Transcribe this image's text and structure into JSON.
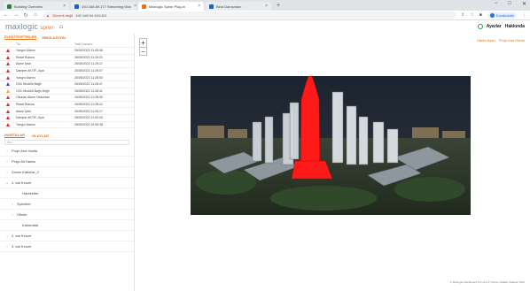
{
  "browser": {
    "tabs": [
      {
        "label": "Building Overview",
        "active": false,
        "color": "#2e7d32"
      },
      {
        "label": "192.168.89.177 Streaming Mon",
        "active": false,
        "color": "#1565c0"
      },
      {
        "label": "Maxlogic Sprwr Plug-in",
        "active": true,
        "color": "#e8711c"
      },
      {
        "label": "Bina Danışmanı",
        "active": false,
        "color": "#1565c0"
      }
    ],
    "new_tab": "+",
    "window_controls": [
      "−",
      "□",
      "✕"
    ],
    "url_warning": "Güvenli değil",
    "url": "192.168.94.34/1451",
    "profile_label": "Duraklatıldı"
  },
  "header": {
    "logo_main": "maxlogic",
    "logo_sub": "sprwr",
    "nav_links": [
      "Ayarlar",
      "Hakkında"
    ]
  },
  "alarms": {
    "tabs": [
      "ELEKTROPTİKLER",
      "SİMÜLASYON"
    ],
    "columns": [
      "Tür",
      "Tarih Zamanı"
    ],
    "rows": [
      {
        "type": "Yangın Alarmı",
        "time": "26/05/2022 11:49:46",
        "color": "#d32f2f"
      },
      {
        "type": "Reset Butonu",
        "time": "26/05/2022 11:29:22",
        "color": "#d32f2f"
      },
      {
        "type": "Alarm İptal",
        "time": "26/05/2022 11:29:17",
        "color": "#d32f2f"
      },
      {
        "type": "Damper AKTİF–Açık",
        "time": "26/05/2022 11:29:07",
        "color": "#d32f2f"
      },
      {
        "type": "Yangın Alarmı",
        "time": "26/05/2022 11:28:53",
        "color": "#d32f2f"
      },
      {
        "type": "GOL Modülü Bağlı",
        "time": "26/05/2022 11:28:47",
        "color": "#3949ab"
      },
      {
        "type": "GOL Modülü Bağlı Değil",
        "time": "26/05/2022 11:28:41",
        "color": "#f9a825"
      },
      {
        "type": "Okunan Alarm Dekontarı",
        "time": "26/05/2022 11:28:30",
        "color": "#d32f2f"
      },
      {
        "type": "Reset Butonu",
        "time": "26/05/2022 11:28:22",
        "color": "#d32f2f"
      },
      {
        "type": "Alarm İptal",
        "time": "26/05/2022 11:00:17",
        "color": "#d32f2f"
      },
      {
        "type": "Damper AKTİF–Açık",
        "time": "26/05/2022 11:00:04",
        "color": "#d32f2f"
      },
      {
        "type": "Yangın Alarmı",
        "time": "26/05/2022 10:59:38",
        "color": "#d32f2f"
      }
    ]
  },
  "tree": {
    "tabs": [
      "HARİTALAR",
      "OLAYLAR"
    ],
    "search_placeholder": "Ara",
    "items": [
      {
        "label": "Proje Ana Harita",
        "level": 0,
        "chevron": "›"
      },
      {
        "label": "Proje Alt Harita",
        "level": 0,
        "chevron": "›"
      },
      {
        "label": "Zemin Katlıklar_2",
        "level": 0,
        "chevron": "›"
      },
      {
        "label": "1. kat Keuze",
        "level": 0,
        "chevron": "⌄"
      },
      {
        "label": "Hareketler",
        "level": 2,
        "chevron": ""
      },
      {
        "label": "Sprinkler",
        "level": 1,
        "chevron": "›"
      },
      {
        "label": "Ofisler",
        "level": 1,
        "chevron": "›"
      },
      {
        "label": "Kameralar",
        "level": 2,
        "chevron": ""
      },
      {
        "label": "2. kat Keuze",
        "level": 0,
        "chevron": "›"
      },
      {
        "label": "3. kat Keuze",
        "level": 0,
        "chevron": "›"
      }
    ]
  },
  "main": {
    "zoom_in": "+",
    "zoom_out": "−",
    "top_links": [
      "Harita Ayarı",
      "Proje Ana Harita"
    ],
    "footer": "© Maxlogic Dashboard Pro v1.0.2 Yazılım Hakları Saklıdır 2022"
  },
  "colors": {
    "accent": "#e8711c",
    "alarm_red": "#d32f2f",
    "highlight_building": "#ff1a1a"
  }
}
